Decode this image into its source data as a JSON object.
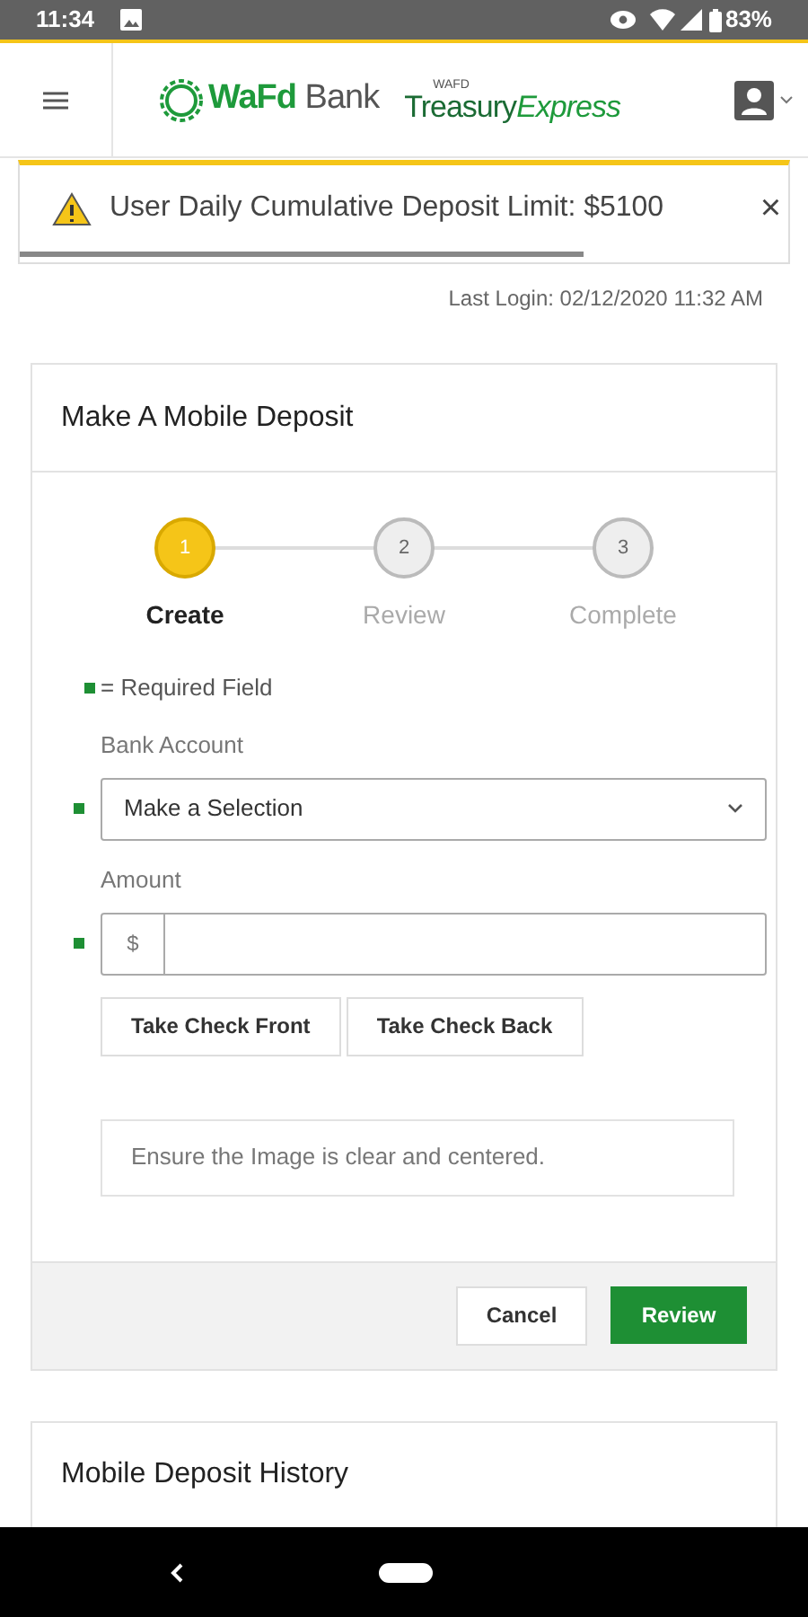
{
  "status_bar": {
    "time": "11:34",
    "battery": "83%"
  },
  "header": {
    "bank_logo": {
      "bold": "WaFd",
      "light": "Bank"
    },
    "product_logo": {
      "small": "WAFD",
      "name": "Treasury",
      "accent": "Express"
    }
  },
  "alert": {
    "text": "User Daily Cumulative Deposit Limit: $5100",
    "close": "×"
  },
  "last_login": "Last Login: 02/12/2020 11:32 AM",
  "deposit_card": {
    "title": "Make A Mobile Deposit",
    "steps": [
      {
        "number": "1",
        "label": "Create",
        "selected": true
      },
      {
        "number": "2",
        "label": "Review",
        "selected": false
      },
      {
        "number": "3",
        "label": "Complete",
        "selected": false
      }
    ],
    "required_legend": "= Required Field",
    "fields": [
      {
        "kind": "select",
        "label": "Bank Account",
        "required": true,
        "value": "Make a Selection"
      },
      {
        "kind": "amount",
        "label": "Amount",
        "required": true,
        "prefix": "$"
      }
    ],
    "capture_buttons": [
      "Take Check Front",
      "Take Check Back"
    ],
    "hint": "Ensure the Image is clear and centered.",
    "cancel": "Cancel",
    "submit": "Review"
  },
  "history_card": {
    "title": "Mobile Deposit History"
  }
}
